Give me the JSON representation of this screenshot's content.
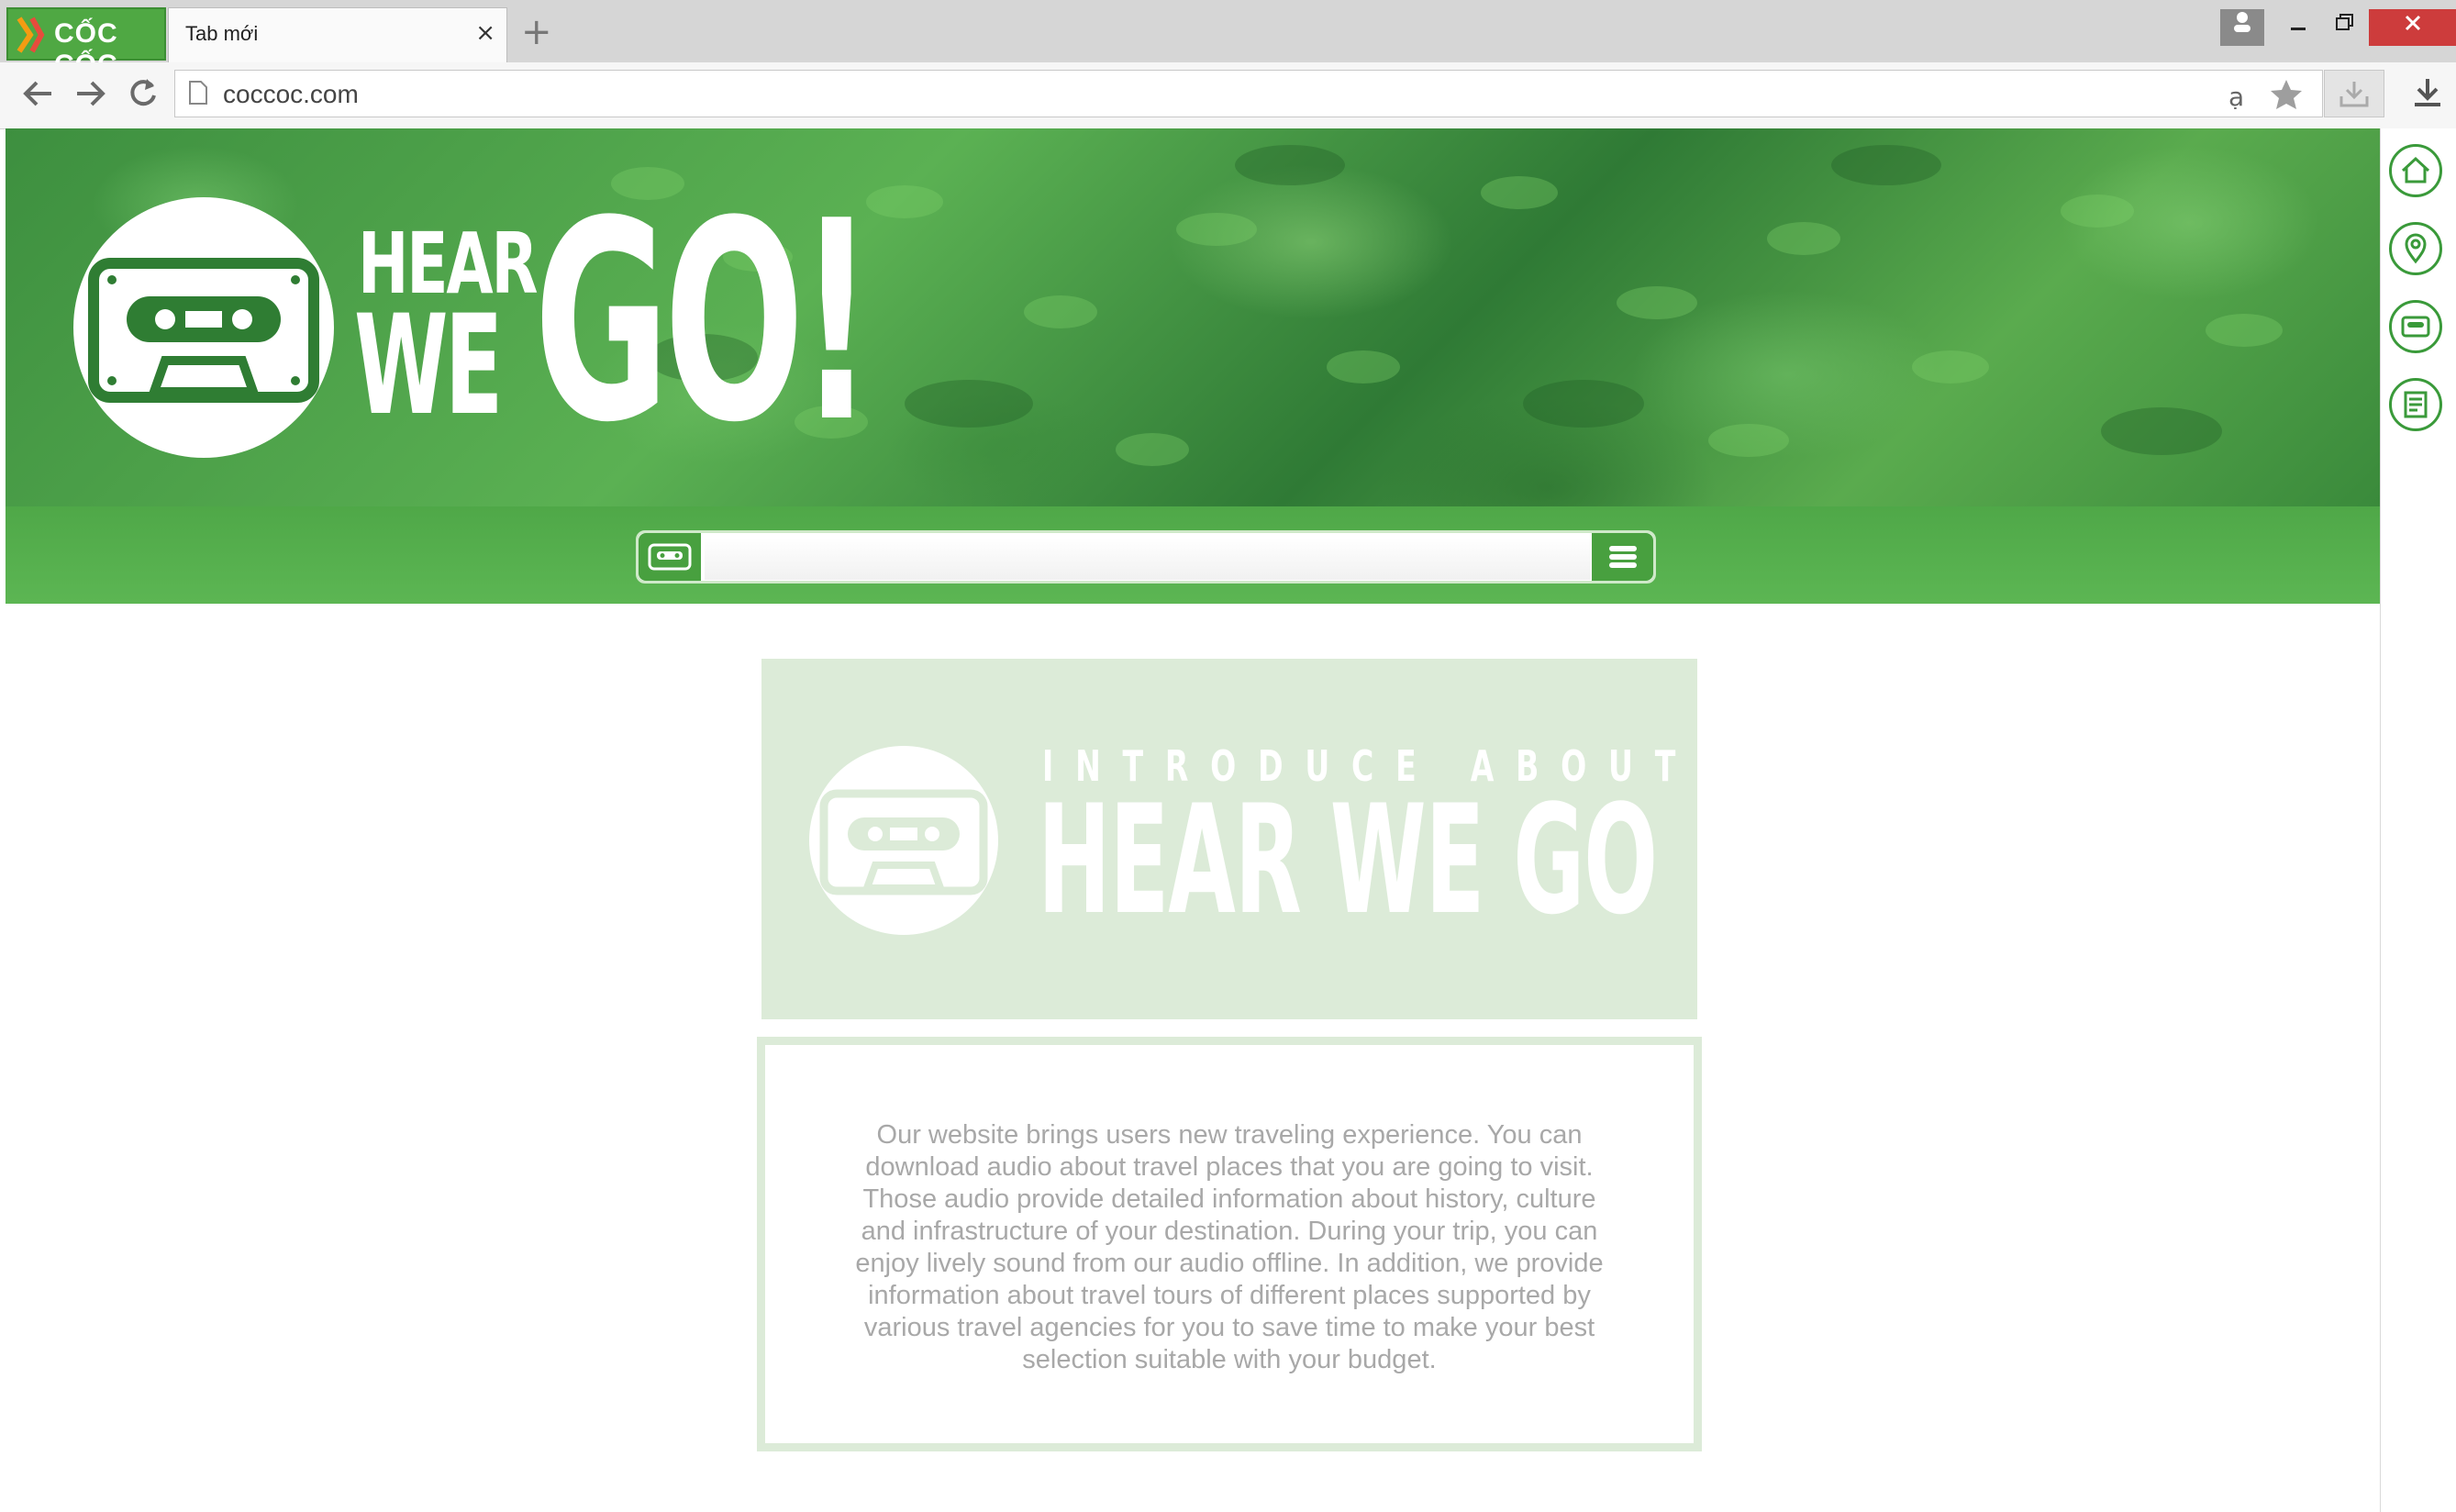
{
  "browser": {
    "brand": "CỐC CỐC",
    "tab_title": "Tab mới",
    "tab_close": "×",
    "new_tab": "+",
    "url": "coccoc.com",
    "window_controls": [
      "minimize",
      "restore",
      "close"
    ]
  },
  "site": {
    "hero_logo_text": {
      "hear": "HEAR",
      "we": "WE",
      "go": "GO!"
    },
    "search": {
      "value": "",
      "left_icon": "cassette-icon",
      "right_icon": "menu-icon"
    },
    "side_nav": [
      "home-icon",
      "location-pin-icon",
      "cassette-icon",
      "document-icon"
    ],
    "intro": {
      "kicker": "INTRODUCE ABOUT",
      "title": "HEAR WE GO"
    },
    "description": "Our website brings users new traveling experience. You can download audio about travel places that you are going to visit. Those audio provide detailed information about history, culture and infrastructure of your destination. During your trip, you can enjoy lively sound from our audio offline. In addition, we provide information about travel tours of different places supported by various travel agencies for you to save time to make your best selection suitable with your budget.",
    "colors": {
      "brand_green": "#4fa848",
      "card_green": "#dcebd8",
      "text_gray": "#a8a8a8"
    }
  }
}
